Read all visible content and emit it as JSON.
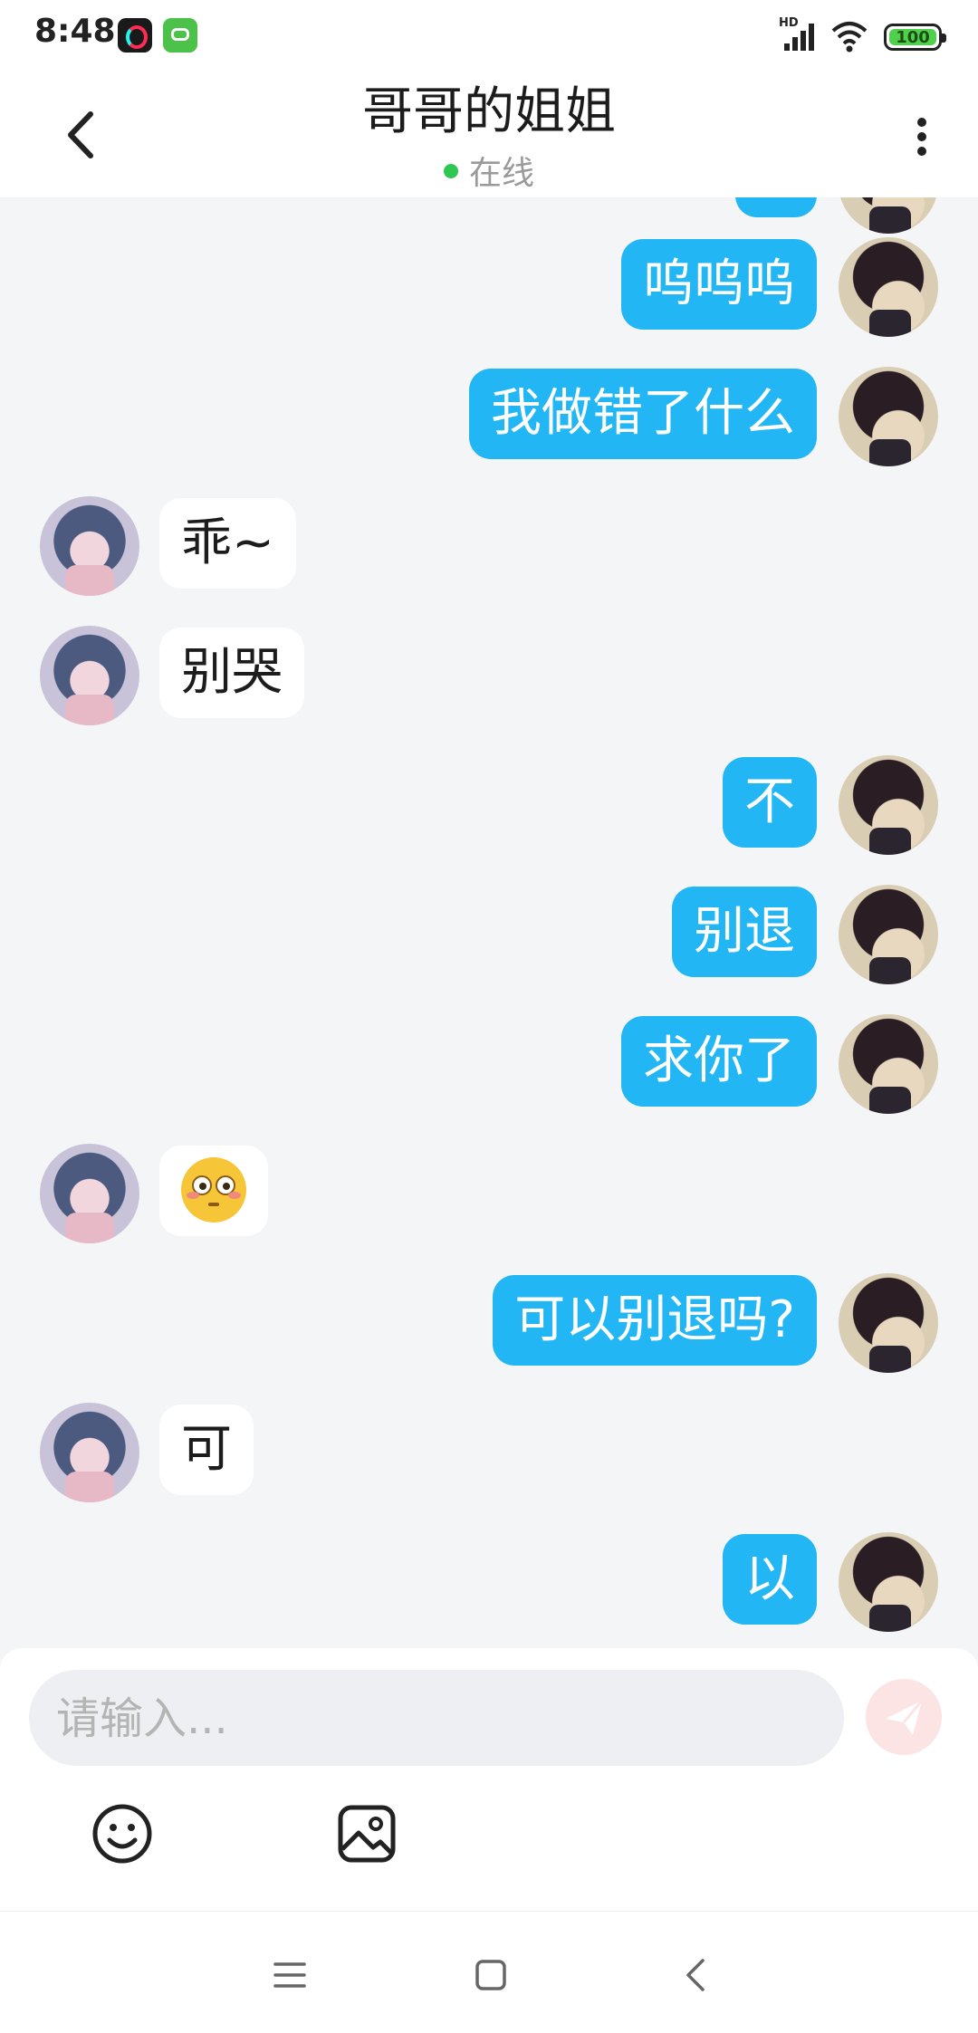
{
  "status_bar": {
    "time": "8:48",
    "battery": "100",
    "network": "HD"
  },
  "header": {
    "title": "哥哥的姐姐",
    "status": "在线"
  },
  "messages": [
    {
      "from": "me",
      "text": "呜呜呜"
    },
    {
      "from": "me",
      "text": "我做错了什么"
    },
    {
      "from": "other",
      "text": "乖~"
    },
    {
      "from": "other",
      "text": "别哭"
    },
    {
      "from": "me",
      "text": "不"
    },
    {
      "from": "me",
      "text": "别退"
    },
    {
      "from": "me",
      "text": "求你了"
    },
    {
      "from": "other",
      "emoji": "flushed-face"
    },
    {
      "from": "me",
      "text": "可以别退吗?"
    },
    {
      "from": "other",
      "text": "可"
    },
    {
      "from": "me",
      "text": "以"
    }
  ],
  "composer": {
    "placeholder": "请输入..."
  },
  "icons": {
    "back": "chevron-left-icon",
    "more": "more-vertical-icon",
    "send": "send-icon",
    "emoji": "smiley-icon",
    "image": "image-icon"
  },
  "colors": {
    "my_bubble": "#23b6f4",
    "other_bubble": "#ffffff",
    "online_dot": "#2ec750",
    "background": "#f4f5f7"
  }
}
